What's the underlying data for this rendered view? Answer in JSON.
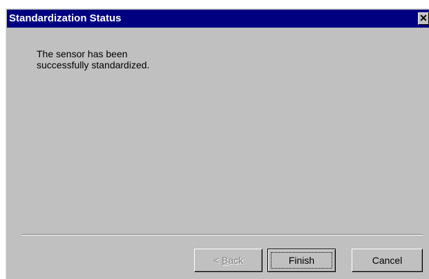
{
  "dialog": {
    "title": "Standardization Status",
    "close_glyph": "✕",
    "message_lines": [
      "The sensor has been",
      "successfully standardized."
    ]
  },
  "buttons": {
    "back_prefix": "< ",
    "back_accel": "B",
    "back_rest": "ack",
    "back_enabled": false,
    "finish": "Finish",
    "cancel": "Cancel"
  },
  "colors": {
    "titlebar": "#000080",
    "dialog_face": "#c0c0c0",
    "disabled_text": "#808080"
  }
}
